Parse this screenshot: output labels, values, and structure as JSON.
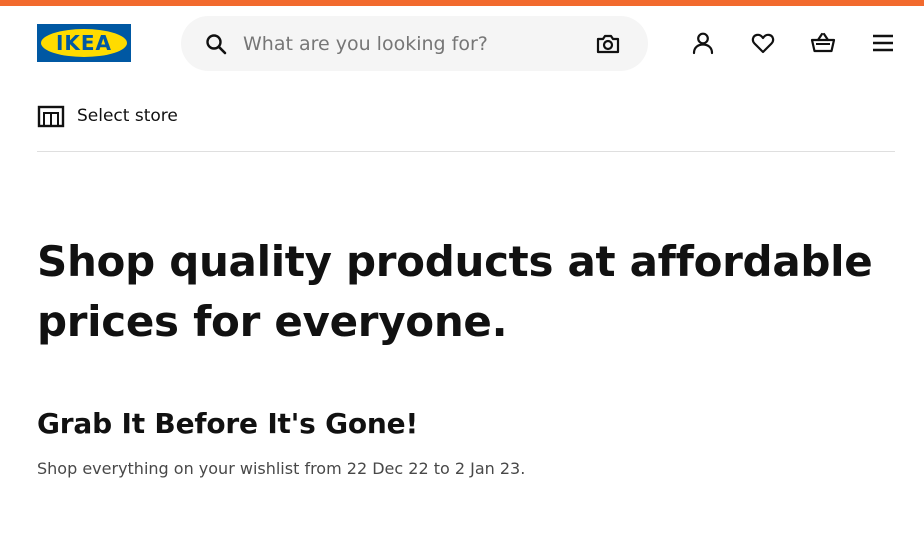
{
  "colors": {
    "top_stripe": "#f26a2e",
    "logo_blue": "#0058a3",
    "logo_yellow": "#ffdb00",
    "search_bg": "#f5f5f5",
    "text_primary": "#111111",
    "text_secondary": "#484848"
  },
  "logo": {
    "text": "IKEA",
    "icon": "ikea-logo"
  },
  "search": {
    "placeholder": "What are you looking for?",
    "value": "",
    "leading_icon": "search-icon",
    "trailing_icon": "camera-icon"
  },
  "nav": {
    "icons": [
      "account-icon",
      "heart-icon",
      "basket-icon",
      "menu-icon"
    ]
  },
  "store": {
    "icon": "store-icon",
    "label": "Select store"
  },
  "hero": {
    "line1": "Shop quality products at affordable",
    "line2": "prices for everyone."
  },
  "promo": {
    "title": "Grab It Before It's Gone!",
    "text": "Shop everything on your wishlist from 22 Dec 22 to 2 Jan 23."
  }
}
